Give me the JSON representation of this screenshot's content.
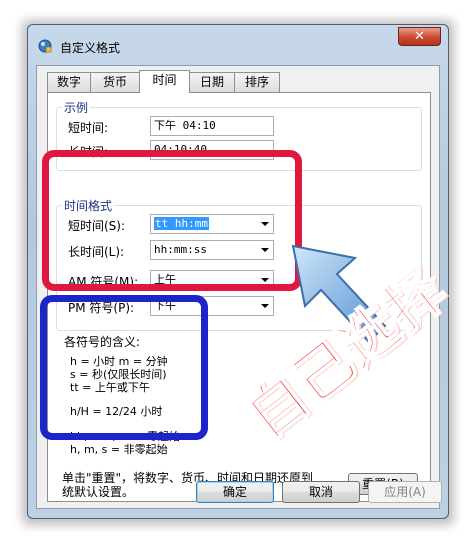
{
  "window": {
    "title": "自定义格式",
    "close_glyph": "✕"
  },
  "tabs": [
    {
      "label": "数字"
    },
    {
      "label": "货币"
    },
    {
      "label": "时间"
    },
    {
      "label": "日期"
    },
    {
      "label": "排序"
    }
  ],
  "active_tab": "时间",
  "example": {
    "group_title": "示例",
    "short_label": "短时间:",
    "short_value": "下午 04:10",
    "long_label": "长时间:",
    "long_value": "04:10:40"
  },
  "time_format": {
    "group_title": "时间格式",
    "short_label": "短时间(S):",
    "short_value": "tt hh:mm",
    "long_label": "长时间(L):",
    "long_value": "hh:mm:ss",
    "am_label": "AM 符号(M):",
    "am_value": "上午",
    "pm_label": "PM 符号(P):",
    "pm_value": "下午"
  },
  "legend": {
    "title": "各符号的含义:",
    "line1": "h = 小时   m = 分钟",
    "line2": "s = 秒(仅限长时间)",
    "line3": "tt = 上午或下午",
    "line4": "h/H = 12/24 小时",
    "line5": "hh, mm, ss = 零起始",
    "line6": "h, m, s = 非零起始"
  },
  "reset_note": {
    "line1": "单击\"重置\"，将数字、货币、时间和日期还原到",
    "line2": "统默认设置。"
  },
  "buttons": {
    "reset": "重置(R)",
    "ok": "确定",
    "cancel": "取消",
    "apply": "应用(A)"
  },
  "annotation": {
    "text": "自己选择",
    "red_box_color": "#e0183f",
    "blue_box_color": "#1c25c9",
    "arrow_color": "#6aa6dc"
  }
}
